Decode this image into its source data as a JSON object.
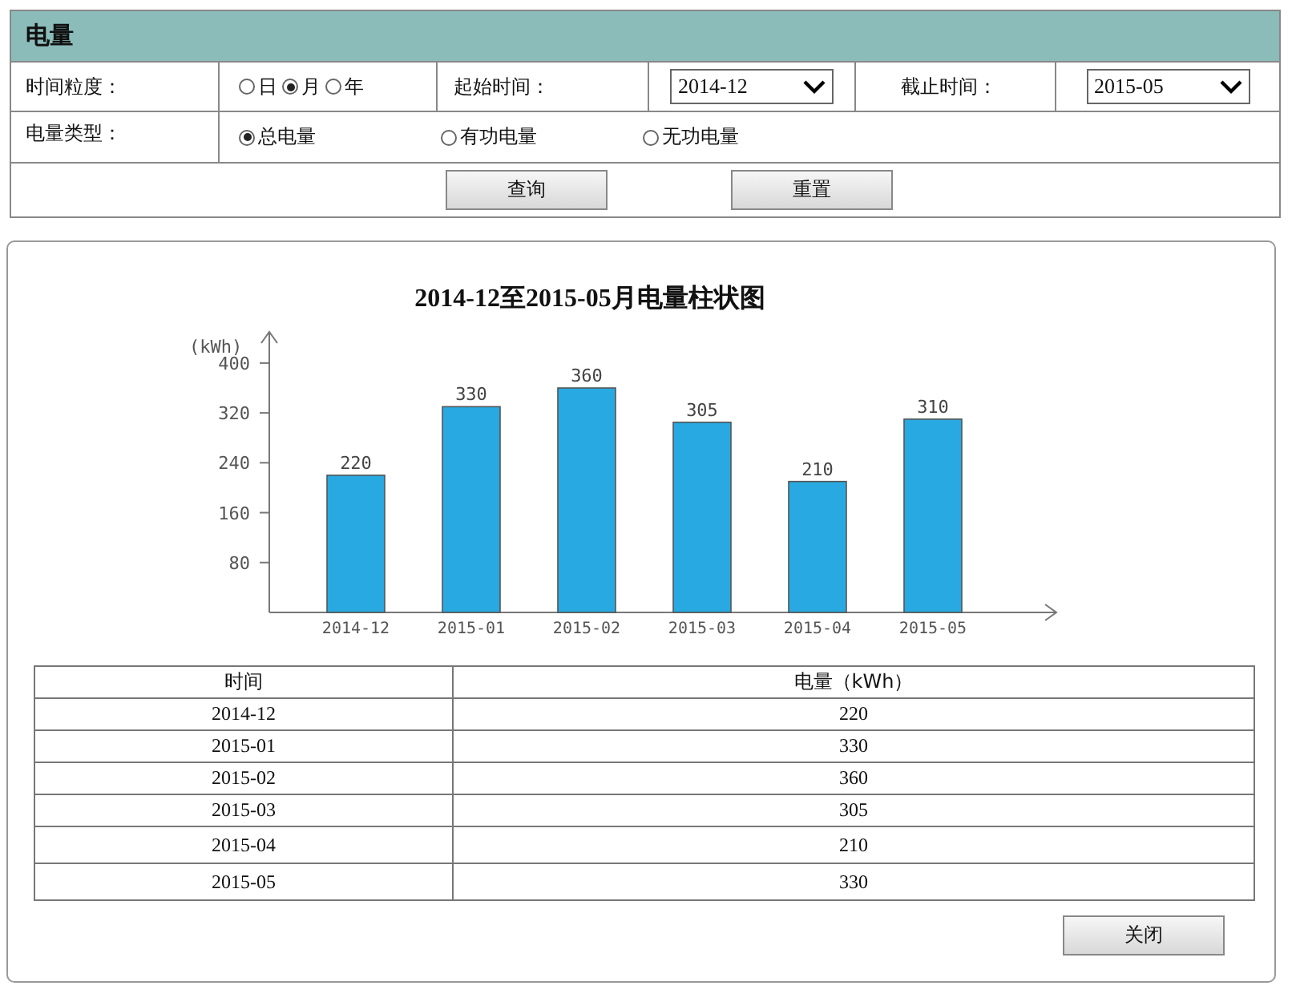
{
  "panel": {
    "title": "电量"
  },
  "filters": {
    "granularity": {
      "label": "时间粒度：",
      "options": [
        {
          "label": "日",
          "selected": false
        },
        {
          "label": "月",
          "selected": true
        },
        {
          "label": "年",
          "selected": false
        }
      ]
    },
    "start": {
      "label": "起始时间：",
      "value": "2014-12"
    },
    "end": {
      "label": "截止时间：",
      "value": "2015-05"
    },
    "type": {
      "label": "电量类型：",
      "options": [
        {
          "label": "总电量",
          "selected": true
        },
        {
          "label": "有功电量",
          "selected": false
        },
        {
          "label": "无功电量",
          "selected": false
        }
      ]
    }
  },
  "buttons": {
    "query": "查询",
    "reset": "重置",
    "close": "关闭"
  },
  "chart": {
    "chart_data": {
      "type": "bar",
      "title": "2014-12至2015-05月电量柱状图",
      "ylabel": "(kWh)",
      "categories": [
        "2014-12",
        "2015-01",
        "2015-02",
        "2015-03",
        "2015-04",
        "2015-05"
      ],
      "values": [
        220,
        330,
        360,
        305,
        210,
        310
      ],
      "ylim": [
        0,
        450
      ],
      "yticks": [
        80,
        160,
        240,
        320,
        400
      ],
      "data_labels": true
    }
  },
  "table": {
    "columns": [
      "时间",
      "电量（kWh）"
    ],
    "rows": [
      [
        "2014-12",
        "220"
      ],
      [
        "2015-01",
        "330"
      ],
      [
        "2015-02",
        "360"
      ],
      [
        "2015-03",
        "305"
      ],
      [
        "2015-04",
        "210"
      ],
      [
        "2015-05",
        "330"
      ]
    ]
  }
}
